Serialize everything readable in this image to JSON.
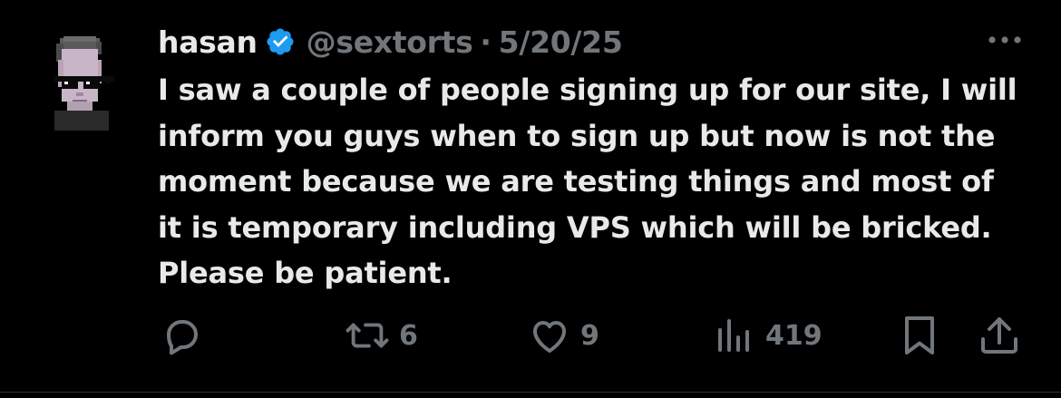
{
  "tweet": {
    "author_name": "hasan",
    "author_handle": "@sextorts",
    "separator": "·",
    "date": "5/20/25",
    "text": "I saw a couple of people signing up for our site, I will inform you guys when to sign up but now is not the moment because we are testing things and most of it is temporary including VPS which will be bricked. Please be patient.",
    "verified": true
  },
  "actions": {
    "reply_icon": "reply-bubble-icon",
    "repost_icon": "repost-icon",
    "repost_count": "6",
    "like_icon": "heart-icon",
    "like_count": "9",
    "views_icon": "bar-chart-icon",
    "views_count": "419",
    "bookmark_icon": "bookmark-icon",
    "share_icon": "share-icon"
  },
  "colors": {
    "background": "#000000",
    "text": "#e7e9ea",
    "muted": "#71767b",
    "verified_blue": "#1d9bf0",
    "divider": "#2f3336"
  }
}
